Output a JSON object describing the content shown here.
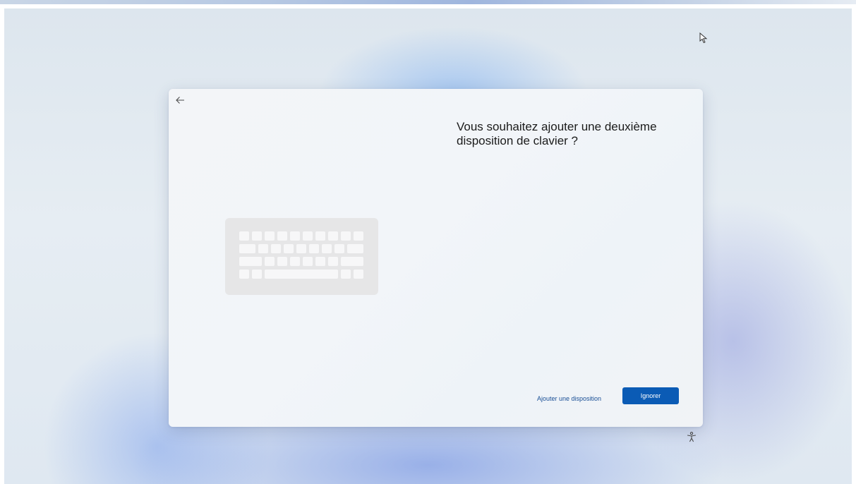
{
  "dialog": {
    "title_line1": "Vous souhaitez ajouter une deuxième",
    "title_line2": "disposition de clavier ?",
    "add_layout_label": "Ajouter une disposition",
    "skip_label": "Ignorer"
  },
  "icons": {
    "back": "back-arrow-icon",
    "illustration": "keyboard-illustration",
    "cursor": "mouse-pointer-icon",
    "accessibility": "accessibility-icon"
  },
  "colors": {
    "primary_button": "#0b5bb5",
    "link_text": "#1a4f96",
    "title_text": "#1b1b1b"
  }
}
